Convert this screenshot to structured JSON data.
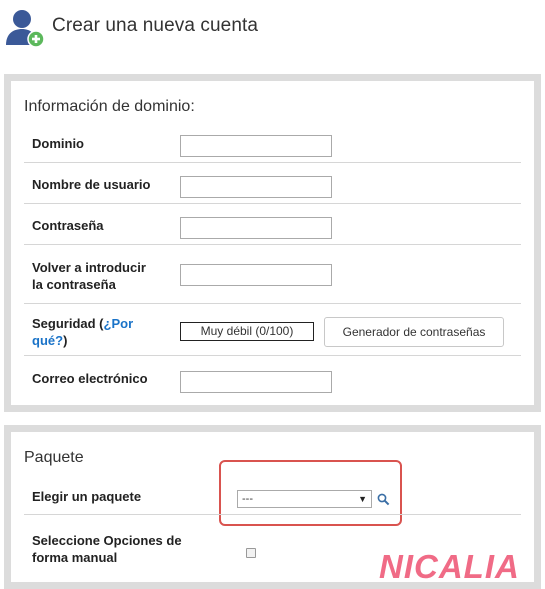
{
  "header": {
    "title": "Crear una nueva cuenta",
    "icon": "add-user-icon"
  },
  "domain_section": {
    "title": "Información de dominio:",
    "fields": {
      "domain_label": "Dominio",
      "username_label": "Nombre de usuario",
      "password_label": "Contraseña",
      "confirm_label_line1": "Volver a introducir",
      "confirm_label_line2": "la contraseña",
      "security_label_prefix": "Seguridad (",
      "security_link_part1": "¿Por",
      "security_link_part2": "qué?",
      "security_label_suffix": ")",
      "email_label": "Correo electrónico"
    },
    "strength_value": "Muy débil (0/100)",
    "generator_button": "Generador de contraseñas"
  },
  "package_section": {
    "title": "Paquete",
    "choose_label": "Elegir un paquete",
    "select_value": "---",
    "manual_label_line1": "Seleccione Opciones de",
    "manual_label_line2": "forma manual",
    "manual_checked": false
  },
  "brand": {
    "logo_text": "NICALIA",
    "color": "#f06b86"
  },
  "colors": {
    "highlight": "#d9534f",
    "link": "#1a73c8"
  }
}
